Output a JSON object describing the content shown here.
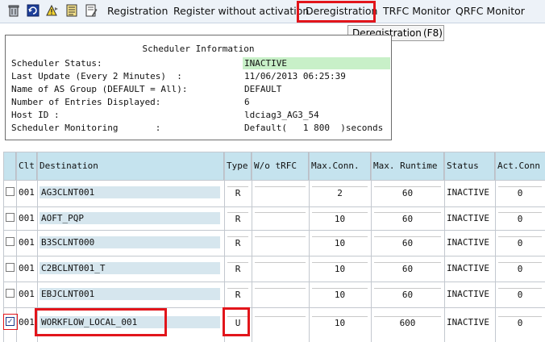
{
  "toolbar": {
    "icons": [
      "delete-icon",
      "refresh-icon",
      "alert-icon",
      "list-details-icon",
      "document-edit-icon"
    ],
    "buttons": [
      "Registration",
      "Register without activation",
      "Deregistration",
      "TRFC Monitor",
      "QRFC Monitor"
    ]
  },
  "tooltip": {
    "text": "Deregistration",
    "shortcut": "(F8)"
  },
  "scheduler": {
    "title": "Scheduler Information",
    "rows": [
      {
        "label": "Scheduler Status:",
        "value": "INACTIVE"
      },
      {
        "label": "Last Update (Every 2 Minutes)  :",
        "value": "11/06/2013 06:25:39"
      },
      {
        "label": "Name of AS Group (DEFAULT = All):",
        "value": "DEFAULT"
      },
      {
        "label": "Number of Entries Displayed:",
        "value": "6"
      },
      {
        "label": "Host ID :",
        "value": "ldciag3_AG3_54"
      },
      {
        "label": "Scheduler Monitoring       :",
        "value": "Default(   1 800  )seconds"
      }
    ],
    "status_color": "#c8f0c8"
  },
  "table": {
    "columns": [
      "Clt",
      "Destination",
      "Type",
      "W/o tRFC",
      "Max.Conn.",
      "Max. Runtime",
      "Status",
      "Act.Conn"
    ],
    "rows": [
      {
        "checked": false,
        "clt": "001",
        "destination": "AG3CLNT001",
        "type": "R",
        "wo_trfc": "",
        "max_conn": "2",
        "max_runtime": "60",
        "status": "INACTIVE",
        "act_conn": "0"
      },
      {
        "checked": false,
        "clt": "001",
        "destination": "AOFT_PQP",
        "type": "R",
        "wo_trfc": "",
        "max_conn": "10",
        "max_runtime": "60",
        "status": "INACTIVE",
        "act_conn": "0"
      },
      {
        "checked": false,
        "clt": "001",
        "destination": "B3SCLNT000",
        "type": "R",
        "wo_trfc": "",
        "max_conn": "10",
        "max_runtime": "60",
        "status": "INACTIVE",
        "act_conn": "0"
      },
      {
        "checked": false,
        "clt": "001",
        "destination": "C2BCLNT001_T",
        "type": "R",
        "wo_trfc": "",
        "max_conn": "10",
        "max_runtime": "60",
        "status": "INACTIVE",
        "act_conn": "0"
      },
      {
        "checked": false,
        "clt": "001",
        "destination": "EBJCLNT001",
        "type": "R",
        "wo_trfc": "",
        "max_conn": "10",
        "max_runtime": "60",
        "status": "INACTIVE",
        "act_conn": "0"
      },
      {
        "checked": true,
        "clt": "001",
        "destination": "WORKFLOW_LOCAL_001",
        "type": "U",
        "wo_trfc": "",
        "max_conn": "10",
        "max_runtime": "600",
        "status": "INACTIVE",
        "act_conn": "0"
      }
    ]
  },
  "colors": {
    "highlight_frame": "#e2151b",
    "header_bg": "#c5e3ee",
    "destination_bg": "#d6e6ee"
  }
}
